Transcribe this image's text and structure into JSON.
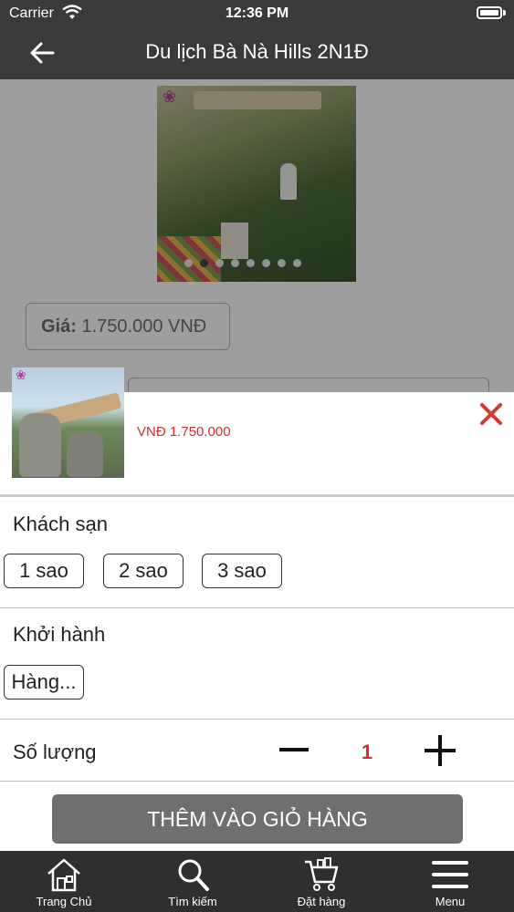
{
  "status_bar": {
    "carrier": "Carrier",
    "time": "12:36 PM"
  },
  "nav": {
    "title": "Du lịch Bà Nà Hills 2N1Đ"
  },
  "product": {
    "price_label": "Giá:",
    "price_value": "1.750.000 VNĐ",
    "carousel": {
      "total": 8,
      "active": 2
    }
  },
  "sheet": {
    "price": "VNĐ 1.750.000",
    "hotel": {
      "label": "Khách sạn",
      "options": [
        "1 sao",
        "2 sao",
        "3 sao"
      ]
    },
    "departure": {
      "label": "Khởi hành",
      "options": [
        "Hàng..."
      ]
    },
    "quantity": {
      "label": "Số lượng",
      "value": "1"
    },
    "add_to_cart": "THÊM VÀO GIỎ HÀNG"
  },
  "tabbar": {
    "items": [
      {
        "label": "Trang Chủ",
        "icon": "home-icon"
      },
      {
        "label": "Tìm kiếm",
        "icon": "search-icon"
      },
      {
        "label": "Đặt hàng",
        "icon": "cart-icon"
      },
      {
        "label": "Menu",
        "icon": "menu-icon"
      }
    ]
  },
  "colors": {
    "bar": "#3b3a3a",
    "accent_red": "#d32f2f",
    "button_gray": "#6f6f6f"
  }
}
